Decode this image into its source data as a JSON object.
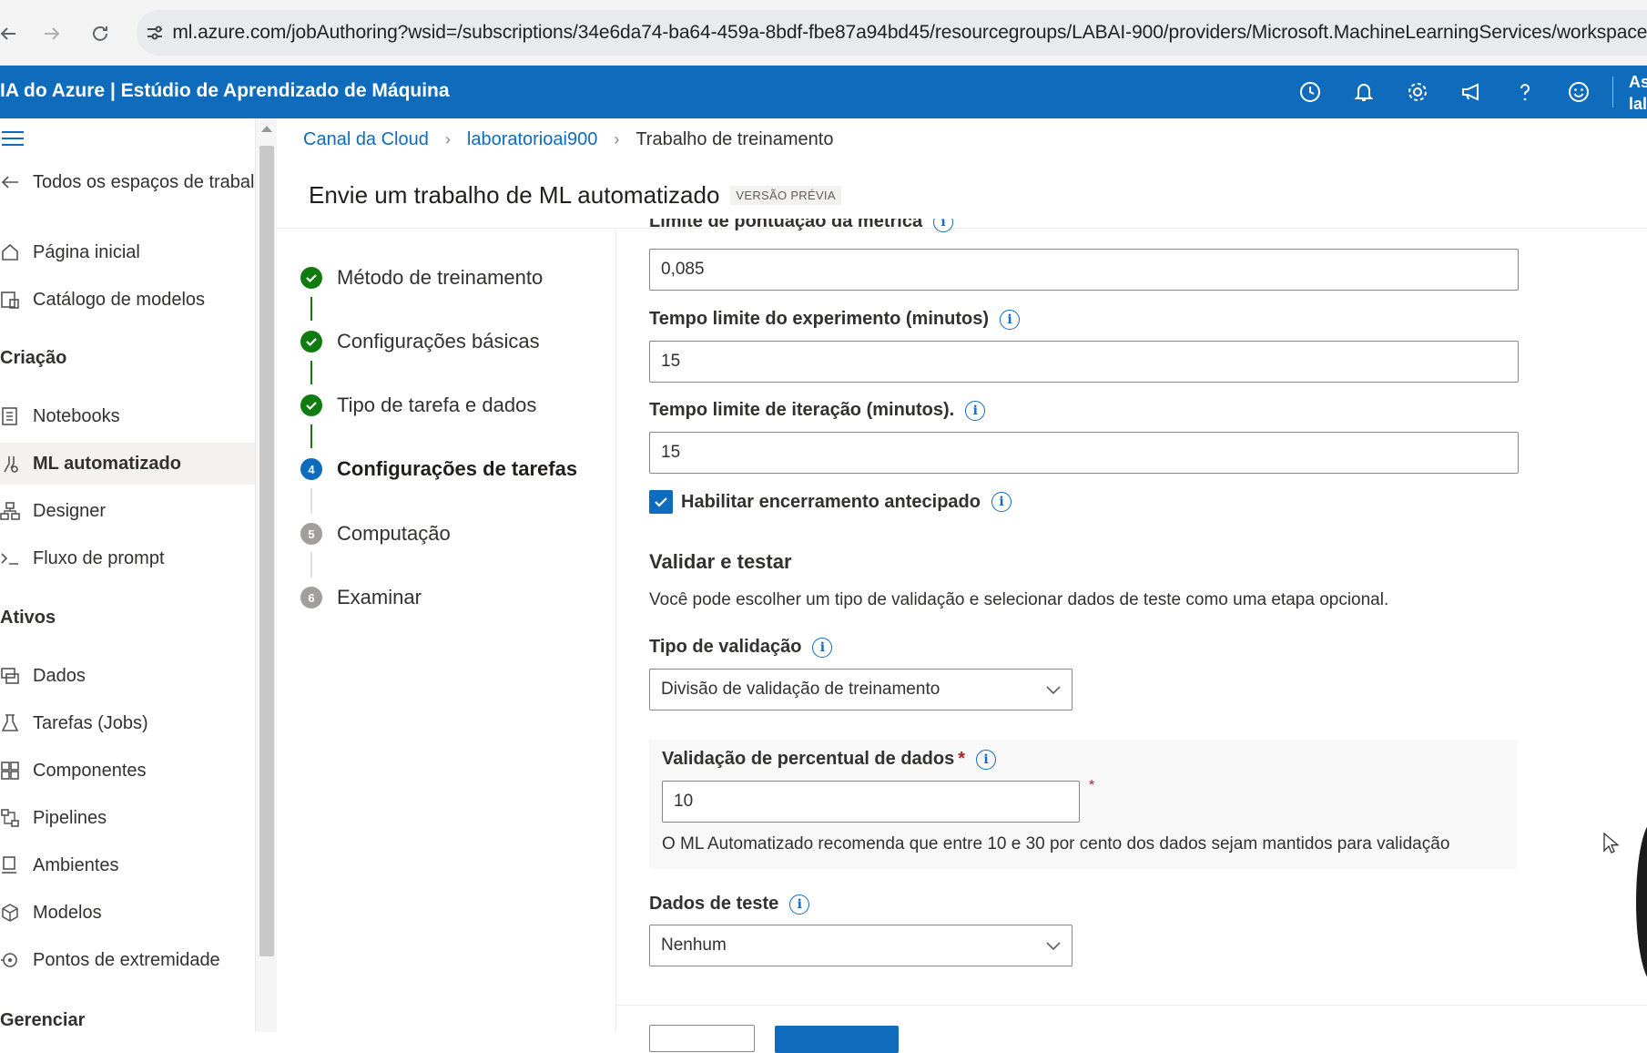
{
  "browser": {
    "url": "ml.azure.com/jobAuthoring?wsid=/subscriptions/34e6da74-ba64-459a-8bdf-fbe87a94bd45/resourcegroups/LABAI-900/providers/Microsoft.MachineLearningServices/workspaces/l"
  },
  "header": {
    "app_title": "IA do Azure | Estúdio de Aprendizado de Máquina",
    "account_line1": "As",
    "account_line2": "lal"
  },
  "nav": {
    "back_label": "Todos os espaços de trabal",
    "home": "Página inicial",
    "catalog": "Catálogo de modelos",
    "section_creation": "Criação",
    "notebooks": "Notebooks",
    "automl": "ML automatizado",
    "designer": "Designer",
    "prompt_flow": "Fluxo de prompt",
    "section_assets": "Ativos",
    "data": "Dados",
    "jobs": "Tarefas (Jobs)",
    "components": "Componentes",
    "pipelines": "Pipelines",
    "environments": "Ambientes",
    "models": "Modelos",
    "endpoints": "Pontos de extremidade",
    "section_manage": "Gerenciar"
  },
  "breadcrumb": {
    "item1": "Canal da Cloud",
    "item2": "laboratorioai900",
    "item3": "Trabalho de treinamento"
  },
  "page": {
    "title": "Envie um trabalho de ML automatizado",
    "badge": "VERSÃO PRÉVIA"
  },
  "steps": [
    {
      "num": "1",
      "label": "Método de treinamento",
      "status": "done"
    },
    {
      "num": "2",
      "label": "Configurações básicas",
      "status": "done"
    },
    {
      "num": "3",
      "label": "Tipo de tarefa e dados",
      "status": "done"
    },
    {
      "num": "4",
      "label": "Configurações de tarefas",
      "status": "current"
    },
    {
      "num": "5",
      "label": "Computação",
      "status": "pending"
    },
    {
      "num": "6",
      "label": "Examinar",
      "status": "pending"
    }
  ],
  "form": {
    "metric_score_label": "Limite de pontuação da métrica",
    "metric_score_value": "0,085",
    "experiment_timeout_label": "Tempo limite do experimento (minutos)",
    "experiment_timeout_value": "15",
    "iteration_timeout_label": "Tempo limite de iteração (minutos).",
    "iteration_timeout_value": "15",
    "early_termination_label": "Habilitar encerramento antecipado",
    "early_termination_checked": true,
    "validate_heading": "Validar e testar",
    "validate_desc": "Você pode escolher um tipo de validação e selecionar dados de teste como uma etapa opcional.",
    "validation_type_label": "Tipo de validação",
    "validation_type_value": "Divisão de validação de treinamento",
    "validation_pct_label": "Validação de percentual de dados",
    "validation_pct_value": "10",
    "validation_pct_hint": "O ML Automatizado recomenda que entre 10 e 30 por cento dos dados sejam mantidos para validação",
    "test_data_label": "Dados de teste",
    "test_data_value": "Nenhum",
    "required_mark": "*",
    "info_glyph": "i"
  },
  "colors": {
    "brand_blue": "#0f6cbd",
    "success_green": "#107c10",
    "pending_grey": "#a19f9d"
  }
}
